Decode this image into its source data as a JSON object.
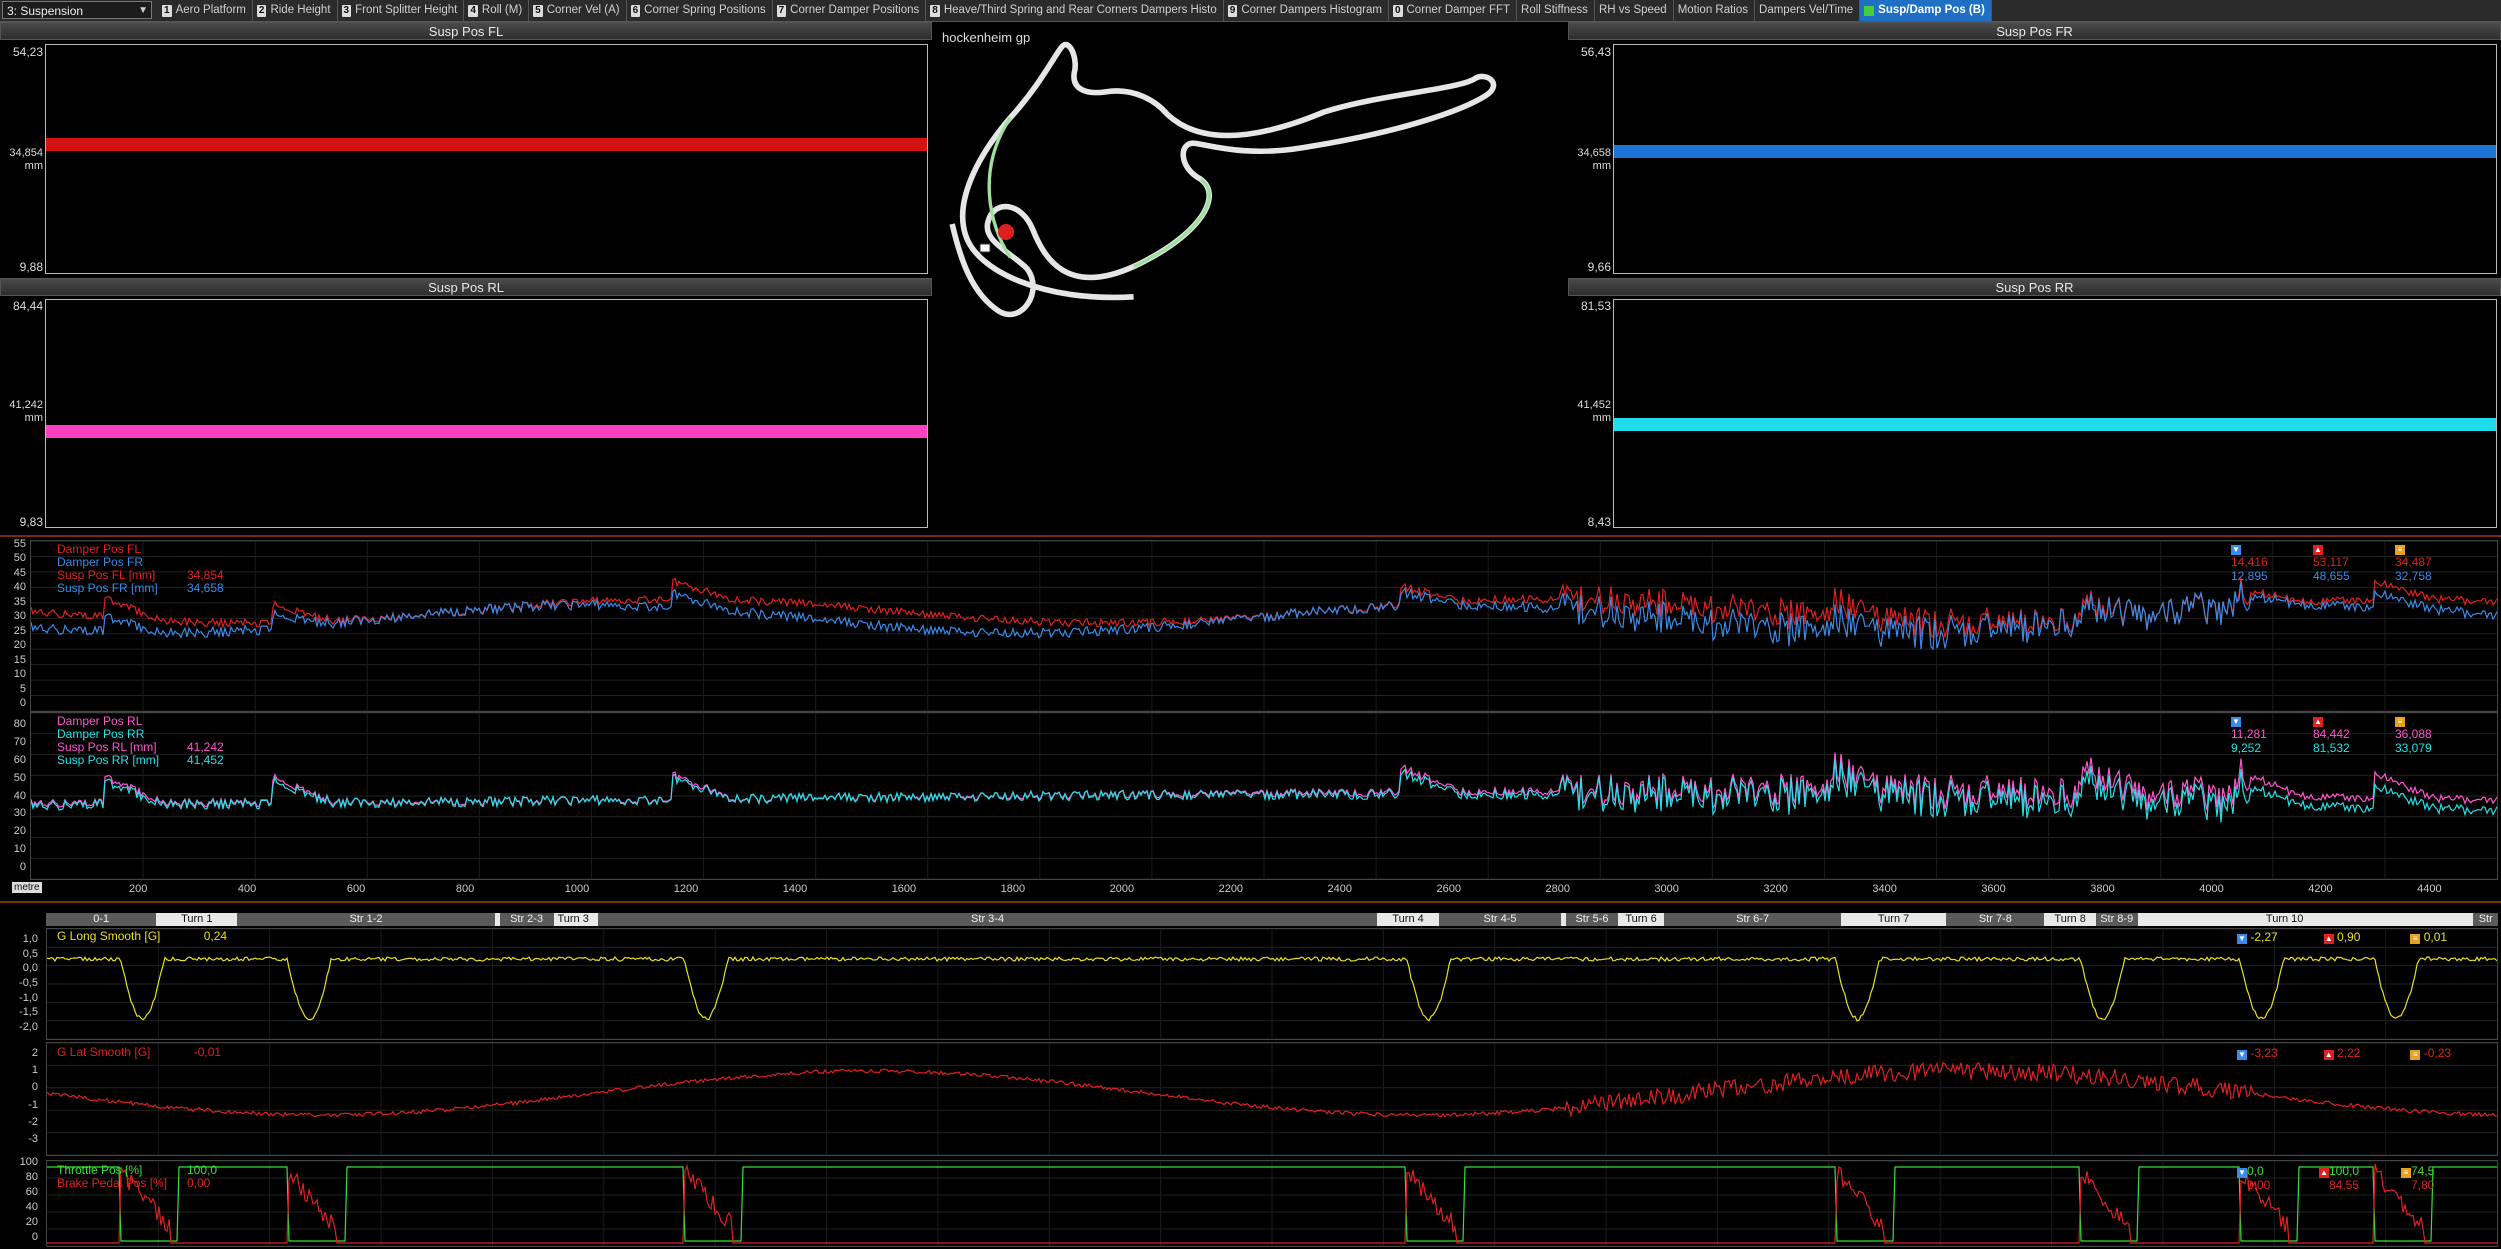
{
  "toolbar": {
    "worksheet_select": "3: Suspension",
    "tabs": [
      {
        "num": "1",
        "label": "Aero Platform"
      },
      {
        "num": "2",
        "label": "Ride Height"
      },
      {
        "num": "3",
        "label": "Front Splitter Height"
      },
      {
        "num": "4",
        "label": "Roll (M)"
      },
      {
        "num": "5",
        "label": "Corner Vel (A)"
      },
      {
        "num": "6",
        "label": "Corner Spring Positions"
      },
      {
        "num": "7",
        "label": "Corner Damper Positions"
      },
      {
        "num": "8",
        "label": "Heave/Third Spring and Rear Corners Dampers Histo"
      },
      {
        "num": "9",
        "label": "Corner Dampers Histogram"
      },
      {
        "num": "0",
        "label": "Corner Damper FFT"
      },
      {
        "num": "",
        "label": "Roll Stiffness"
      },
      {
        "num": "",
        "label": "RH vs Speed"
      },
      {
        "num": "",
        "label": "Motion Ratios"
      },
      {
        "num": "",
        "label": "Dampers Vel/Time"
      },
      {
        "num": "",
        "label": "Susp/Damp Pos (B)",
        "active": true
      }
    ]
  },
  "gauges": {
    "fl": {
      "title": "Susp Pos FL",
      "max": "54,23",
      "value": "34,854",
      "unit": "mm",
      "min": "9,88",
      "level_fraction": 0.566,
      "color": "#d41212"
    },
    "fr": {
      "title": "Susp Pos FR",
      "max": "56,43",
      "value": "34,658",
      "unit": "mm",
      "min": "9,66",
      "level_fraction": 0.535,
      "color": "#1b74d6"
    },
    "rl": {
      "title": "Susp Pos RL",
      "max": "84,44",
      "value": "41,242",
      "unit": "mm",
      "min": "9,83",
      "level_fraction": 0.421,
      "color": "#ff3fc3"
    },
    "rr": {
      "title": "Susp Pos RR",
      "max": "81,53",
      "value": "41,452",
      "unit": "mm",
      "min": "8,43",
      "level_fraction": 0.452,
      "color": "#1fdde8"
    }
  },
  "track": {
    "name": "hockenheim gp"
  },
  "panel1": {
    "yticks": [
      "55",
      "50",
      "45",
      "40",
      "35",
      "30",
      "25",
      "20",
      "15",
      "10",
      "5",
      "0"
    ],
    "legend": [
      {
        "label": "Damper Pos FL",
        "value": "",
        "color": "#e02020"
      },
      {
        "label": "Damper Pos FR",
        "value": "",
        "color": "#3a8ae8"
      },
      {
        "label": "Susp Pos FL [mm]",
        "value": "34,854",
        "color": "#e02020"
      },
      {
        "label": "Susp Pos FR [mm]",
        "value": "34,658",
        "color": "#3a8ae8"
      }
    ],
    "stats": [
      {
        "min": "14,416",
        "max": "53,117",
        "avg": "34,487",
        "color": "#e02020"
      },
      {
        "min": "12,895",
        "max": "48,655",
        "avg": "32,758",
        "color": "#3a8ae8"
      }
    ]
  },
  "panel2": {
    "yticks": [
      "80",
      "70",
      "60",
      "50",
      "40",
      "30",
      "20",
      "10",
      "0"
    ],
    "legend": [
      {
        "label": "Damper Pos RL",
        "value": "",
        "color": "#ff55cc"
      },
      {
        "label": "Damper Pos RR",
        "value": "",
        "color": "#22e0e8"
      },
      {
        "label": "Susp Pos RL [mm]",
        "value": "41,242",
        "color": "#ff55cc"
      },
      {
        "label": "Susp Pos RR [mm]",
        "value": "41,452",
        "color": "#22e0e8"
      }
    ],
    "stats": [
      {
        "min": "11,281",
        "max": "84,442",
        "avg": "36,088",
        "color": "#ff55cc"
      },
      {
        "min": "9,252",
        "max": "81,532",
        "avg": "33,079",
        "color": "#22e0e8"
      }
    ]
  },
  "xaxis": {
    "unit": "metre",
    "ticks": [
      "200",
      "400",
      "600",
      "800",
      "1000",
      "1200",
      "1400",
      "1600",
      "1800",
      "2000",
      "2200",
      "2400",
      "2600",
      "2800",
      "3000",
      "3200",
      "3400",
      "3600",
      "3800",
      "4000",
      "4200",
      "4400"
    ]
  },
  "segments": [
    {
      "label": "0-1",
      "type": "str",
      "from": 0,
      "to": 0.045
    },
    {
      "label": "Turn 1",
      "type": "turn",
      "from": 0.045,
      "to": 0.078
    },
    {
      "label": "Str 1-2",
      "type": "str",
      "from": 0.078,
      "to": 0.183
    },
    {
      "label": "Str 2-3",
      "type": "str",
      "from": 0.185,
      "to": 0.207
    },
    {
      "label": "Turn 3",
      "type": "turn",
      "from": 0.207,
      "to": 0.223
    },
    {
      "label": "Str 3-4",
      "type": "str",
      "from": 0.225,
      "to": 0.543
    },
    {
      "label": "Turn 4",
      "type": "turn",
      "from": 0.543,
      "to": 0.568
    },
    {
      "label": "Str 4-5",
      "type": "str",
      "from": 0.568,
      "to": 0.618
    },
    {
      "label": "Str 5-6",
      "type": "str",
      "from": 0.62,
      "to": 0.641
    },
    {
      "label": "Turn 6",
      "type": "turn",
      "from": 0.641,
      "to": 0.66
    },
    {
      "label": "Str 6-7",
      "type": "str",
      "from": 0.66,
      "to": 0.732
    },
    {
      "label": "Turn 7",
      "type": "turn",
      "from": 0.732,
      "to": 0.775
    },
    {
      "label": "Str 7-8",
      "type": "str",
      "from": 0.775,
      "to": 0.815
    },
    {
      "label": "Turn 8",
      "type": "turn",
      "from": 0.815,
      "to": 0.836
    },
    {
      "label": "Str 8-9",
      "type": "str",
      "from": 0.836,
      "to": 0.853
    },
    {
      "label": "Turn 10",
      "type": "turn",
      "from": 0.866,
      "to": 0.96
    },
    {
      "label": "Str",
      "type": "str",
      "from": 0.99,
      "to": 1.0
    }
  ],
  "glong": {
    "label": "G Long Smooth [G]",
    "value": "0,24",
    "color": "#e8e020",
    "yticks": [
      "1,0",
      "0,5",
      "0,0",
      "-0,5",
      "-1,0",
      "-1,5",
      "-2,0"
    ],
    "min": "-2,27",
    "max": "0,90",
    "avg": "0,01"
  },
  "glat": {
    "label": "G Lat Smooth [G]",
    "value": "-0,01",
    "color": "#e02020",
    "yticks": [
      "2",
      "1",
      "0",
      "-1",
      "-2",
      "-3"
    ],
    "min": "-3,23",
    "max": "2,22",
    "avg": "-0,23"
  },
  "pedals": {
    "yticks": [
      "100",
      "80",
      "60",
      "40",
      "20",
      "0"
    ],
    "legend": [
      {
        "label": "Throttle Pos [%]",
        "value": "100,0",
        "color": "#35e035"
      },
      {
        "label": "Brake Pedal Pos [%]",
        "value": "0,00",
        "color": "#e02020"
      }
    ],
    "stats": [
      {
        "min": "0,0",
        "max": "100,0",
        "avg": "74,5",
        "color": "#35e035"
      },
      {
        "min": "0,00",
        "max": "84,55",
        "avg": "7,80",
        "color": "#e02020"
      }
    ]
  },
  "colors": {
    "stat_min": "#3a8ae8",
    "stat_max": "#e02020",
    "stat_avg": "#e8a020"
  }
}
